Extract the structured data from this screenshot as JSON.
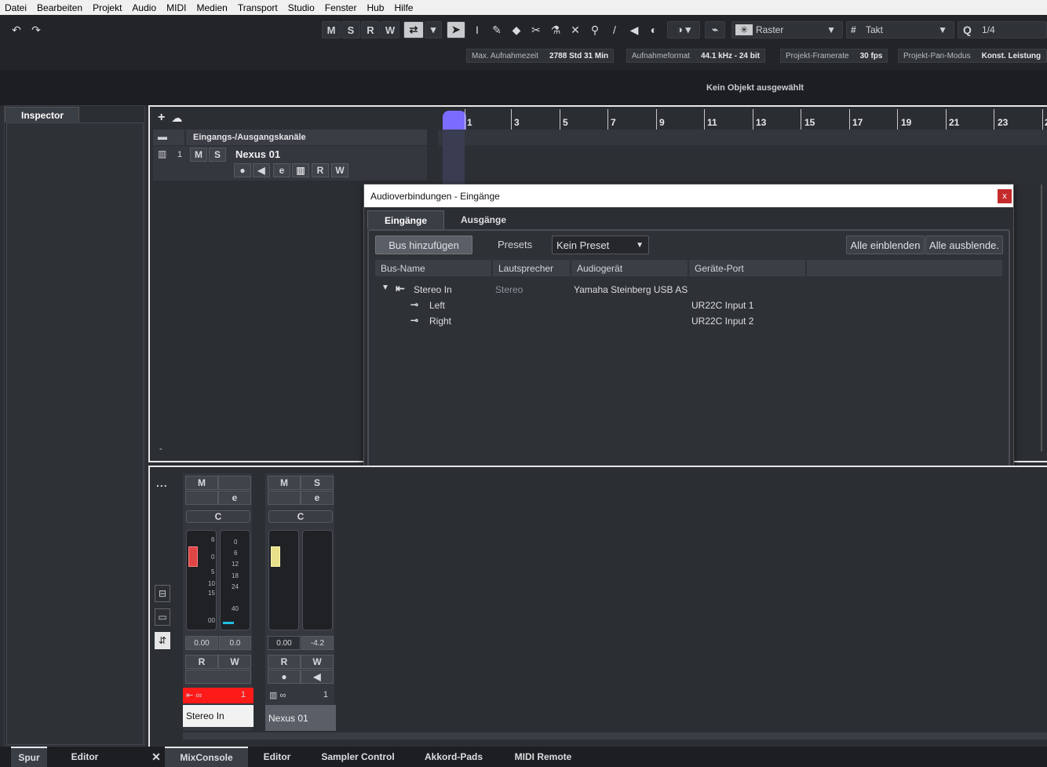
{
  "menu": [
    "Datei",
    "Bearbeiten",
    "Projekt",
    "Audio",
    "MIDI",
    "Medien",
    "Transport",
    "Studio",
    "Fenster",
    "Hub",
    "Hilfe"
  ],
  "toolbar": {
    "undo_icon": "undo-icon",
    "redo_icon": "redo-icon",
    "m": "M",
    "s": "S",
    "r": "R",
    "w": "W",
    "snap_type": "Raster",
    "grid_type": "Takt",
    "quantize": "1/4",
    "q_label": "Q"
  },
  "info": {
    "rec_time_label": "Max. Aufnahmezeit",
    "rec_time": "2788 Std 31 Min",
    "format_label": "Aufnahmeformat",
    "format": "44.1 kHz - 24 bit",
    "framerate_label": "Projekt-Framerate",
    "framerate": "30 fps",
    "pan_label": "Projekt-Pan-Modus",
    "pan": "Konst. Leistung"
  },
  "status": "Kein Objekt ausgewählt",
  "inspector": {
    "tab": "Inspector"
  },
  "tracks": {
    "folder_label": "Eingangs-/Ausgangskanäle",
    "track_num": "1",
    "track_name": "Nexus 01",
    "m": "M",
    "s": "S",
    "r": "R",
    "w": "W",
    "dash": "-"
  },
  "ruler": [
    "1",
    "3",
    "5",
    "7",
    "9",
    "11",
    "13",
    "15",
    "17",
    "19",
    "21",
    "23",
    "2"
  ],
  "dialog": {
    "title": "Audioverbindungen - Eingänge",
    "close": "x",
    "tabs": [
      "Eingänge",
      "Ausgänge"
    ],
    "add_bus": "Bus hinzufügen",
    "presets_label": "Presets",
    "preset_value": "Kein Preset",
    "show_all": "Alle einblenden",
    "hide_all": "Alle ausblende.",
    "columns": [
      "Bus-Name",
      "Lautsprecher",
      "Audiogerät",
      "Geräte-Port"
    ],
    "bus": {
      "name": "Stereo In",
      "speaker": "Stereo",
      "device": "Yamaha Steinberg USB ASIO"
    },
    "ports": [
      {
        "name": "Left",
        "port": "UR22C Input 1"
      },
      {
        "name": "Right",
        "port": "UR22C Input 2"
      }
    ]
  },
  "mixer": {
    "more": "...",
    "strips": [
      {
        "name": "Stereo In",
        "m": "M",
        "s": "",
        "r": "R",
        "w": "W",
        "pan": "C",
        "vol": "0.00",
        "peak": "0.0",
        "channel": "1"
      },
      {
        "name": "Nexus 01",
        "m": "M",
        "s": "S",
        "r": "R",
        "w": "W",
        "pan": "C",
        "vol": "0.00",
        "peak": "-4.2",
        "channel": "1"
      }
    ],
    "scale": [
      "6",
      "0",
      "5",
      "10",
      "15",
      "00"
    ],
    "meter_scale": [
      "0",
      "6",
      "12",
      "18",
      "24",
      "40"
    ]
  },
  "bottom_tabs": [
    "Spur",
    "Editor",
    "MixConsole",
    "Editor",
    "Sampler Control",
    "Akkord-Pads",
    "MIDI Remote"
  ],
  "colors": {
    "accent": "#7b6cff",
    "red": "#ff1a1a"
  }
}
